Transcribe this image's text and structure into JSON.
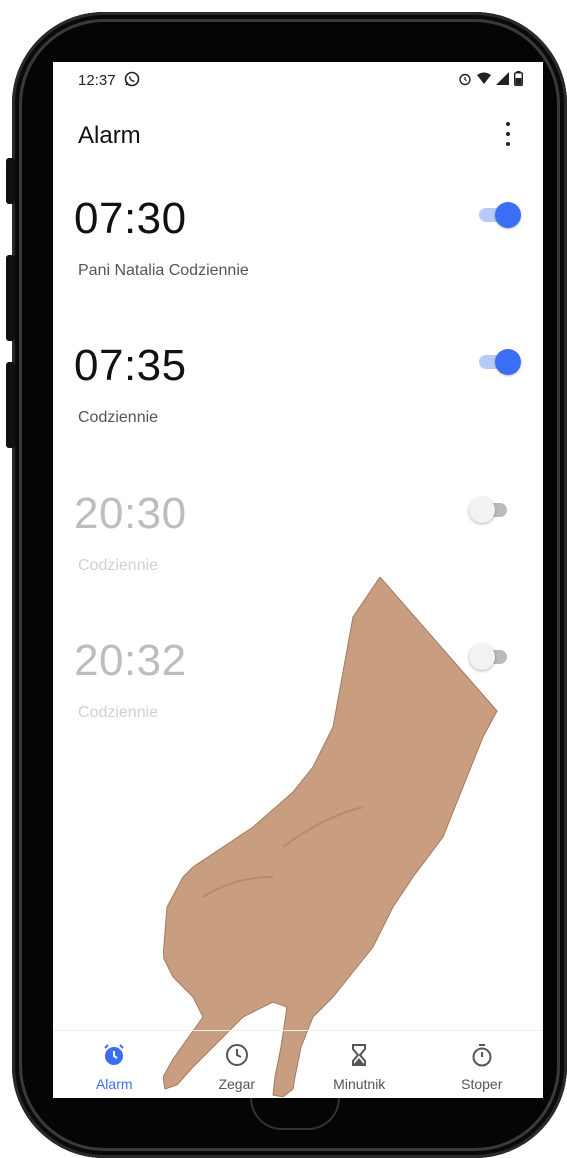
{
  "status_bar": {
    "time": "12:37"
  },
  "app_bar": {
    "title": "Alarm"
  },
  "alarms": [
    {
      "time": "07:30",
      "label": "Pani Natalia  Codziennie",
      "enabled": true
    },
    {
      "time": "07:35",
      "label": "Codziennie",
      "enabled": true
    },
    {
      "time": "20:30",
      "label": "Codziennie",
      "enabled": false
    },
    {
      "time": "20:32",
      "label": "Codziennie",
      "enabled": false
    }
  ],
  "nav": [
    {
      "label": "Alarm",
      "icon": "alarm-clock-icon",
      "active": true
    },
    {
      "label": "Zegar",
      "icon": "clock-icon",
      "active": false
    },
    {
      "label": "Minutnik",
      "icon": "hourglass-icon",
      "active": false
    },
    {
      "label": "Stoper",
      "icon": "stopwatch-icon",
      "active": false
    }
  ],
  "colors": {
    "accent": "#3b6ef5",
    "text": "#111111",
    "disabled": "#bdbdbd"
  }
}
